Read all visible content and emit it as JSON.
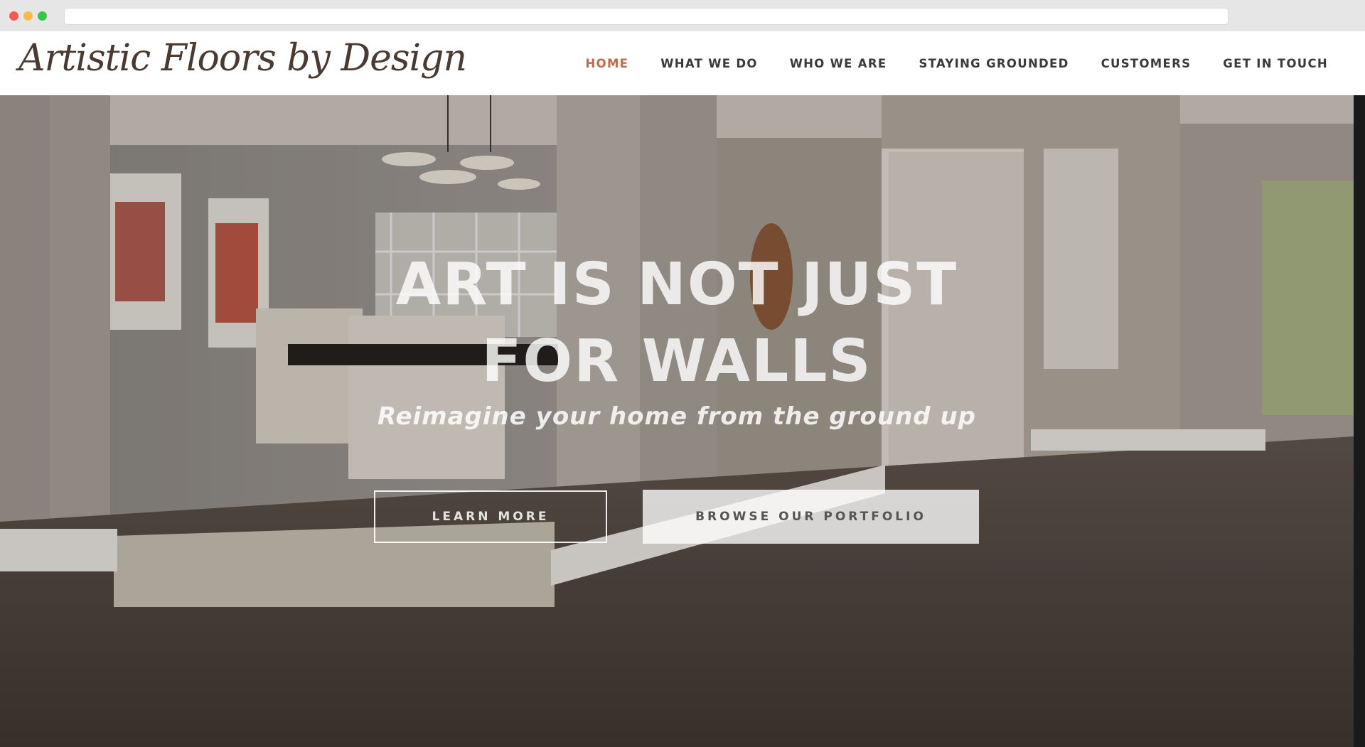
{
  "browser": {
    "url": ""
  },
  "site": {
    "logo_text": "Artistic Floors by Design"
  },
  "nav": {
    "items": [
      {
        "label": "HOME",
        "active": true
      },
      {
        "label": "WHAT WE DO",
        "active": false
      },
      {
        "label": "WHO WE ARE",
        "active": false
      },
      {
        "label": "STAYING GROUNDED",
        "active": false
      },
      {
        "label": "CUSTOMERS",
        "active": false
      },
      {
        "label": "GET IN TOUCH",
        "active": false
      }
    ]
  },
  "hero": {
    "headline_line1": "ART IS NOT JUST",
    "headline_line2": "FOR WALLS",
    "subtitle": "Reimagine your home from the ground up",
    "primary_button": "LEARN MORE",
    "secondary_button": "BROWSE OUR PORTFOLIO"
  },
  "colors": {
    "accent": "#c8664a",
    "nav_text": "#3a3a3a",
    "logo": "#4a3a30"
  }
}
